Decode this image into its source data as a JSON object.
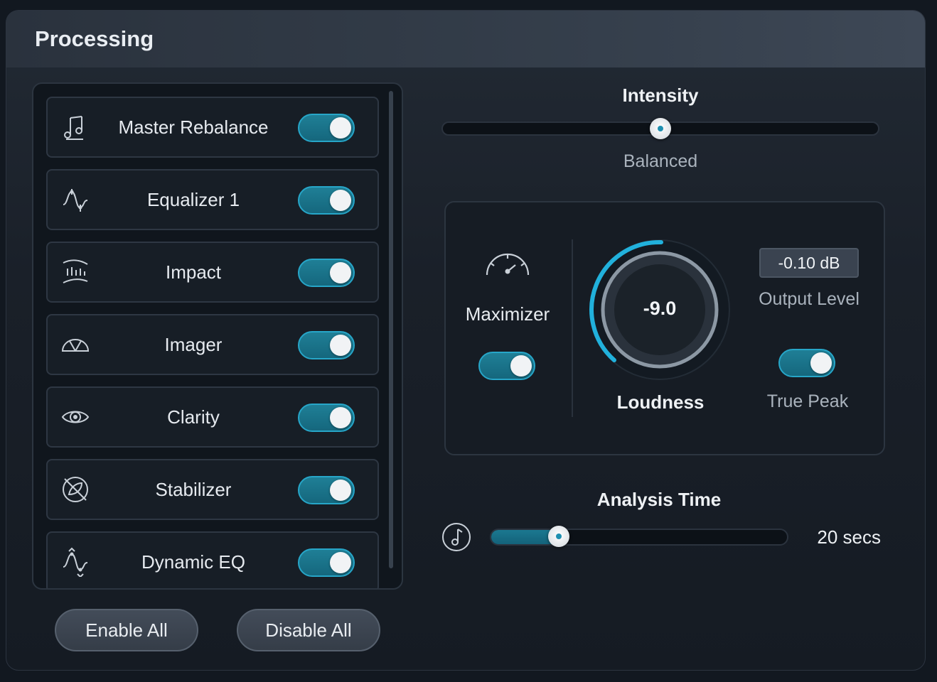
{
  "panel": {
    "title": "Processing"
  },
  "modules": [
    {
      "label": "Master Rebalance",
      "icon": "music-notes-icon",
      "enabled": true
    },
    {
      "label": "Equalizer 1",
      "icon": "eq-curve-icon",
      "enabled": true
    },
    {
      "label": "Impact",
      "icon": "impact-icon",
      "enabled": true
    },
    {
      "label": "Imager",
      "icon": "imager-icon",
      "enabled": true
    },
    {
      "label": "Clarity",
      "icon": "eye-icon",
      "enabled": true
    },
    {
      "label": "Stabilizer",
      "icon": "stabilizer-icon",
      "enabled": true
    },
    {
      "label": "Dynamic EQ",
      "icon": "dynamic-eq-icon",
      "enabled": true
    }
  ],
  "buttons": {
    "enable_all": "Enable All",
    "disable_all": "Disable All"
  },
  "intensity": {
    "title": "Intensity",
    "value_label": "Balanced",
    "position": 0.5
  },
  "maximizer": {
    "label": "Maximizer",
    "enabled": true,
    "loudness_label": "Loudness",
    "loudness_value": "-9.0",
    "output_level_value": "-0.10 dB",
    "output_level_label": "Output Level",
    "true_peak_label": "True Peak",
    "true_peak_enabled": true
  },
  "analysis": {
    "title": "Analysis Time",
    "value_label": "20 secs",
    "position": 0.23
  },
  "colors": {
    "accent": "#27a6c8",
    "toggle_fill": "#1a7389",
    "background": "#121820"
  }
}
